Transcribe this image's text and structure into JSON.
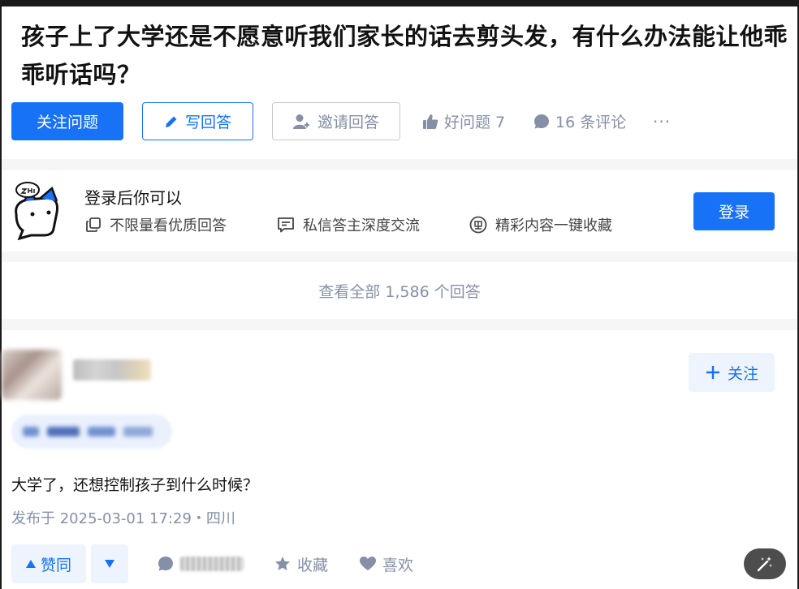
{
  "question": {
    "title": "孩子上了大学还是不愿意听我们家长的话去剪头发，有什么办法能让他乖乖听话吗？",
    "follow_label": "关注问题",
    "write_label": "写回答",
    "invite_label": "邀请回答",
    "good_question_label": "好问题 7",
    "comments_label": "16 条评论",
    "more_label": "···"
  },
  "login_prompt": {
    "title": "登录后你可以",
    "features": [
      "不限量看优质回答",
      "私信答主深度交流",
      "精彩内容一键收藏"
    ],
    "login_label": "登录"
  },
  "view_all_label": "查看全部 1,586 个回答",
  "answer": {
    "follow_label": "关注",
    "content": "大学了，还想控制孩子到什么时候？",
    "time": "发布于 2025-03-01 17:29・四川",
    "upvote_label": "赞同",
    "favorite_label": "收藏",
    "like_label": "喜欢"
  },
  "colors": {
    "brand": "#1772f6",
    "muted": "#8590a6",
    "brand_light": "#eef4fe"
  },
  "icons": [
    "pencil-icon",
    "invite-user-icon",
    "thumbs-up-icon",
    "comment-icon",
    "copy-icon",
    "message-icon",
    "free-badge-icon",
    "plus-icon",
    "triangle-up-icon",
    "triangle-down-icon",
    "star-icon",
    "heart-icon",
    "magic-wand-icon",
    "zhihu-mascot-logo"
  ]
}
